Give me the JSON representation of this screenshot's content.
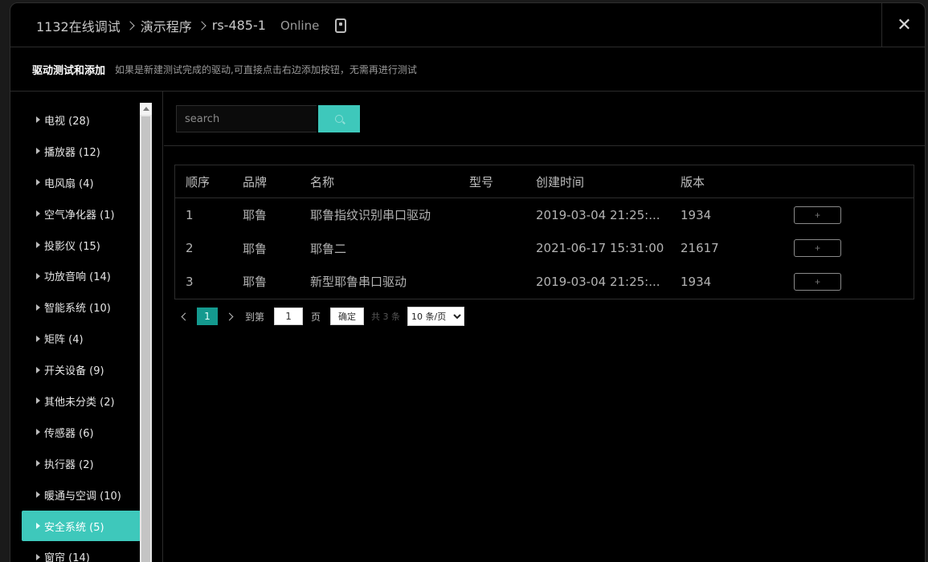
{
  "header": {
    "breadcrumb": [
      "1132在线调试",
      "演示程序",
      "rs-485-1"
    ],
    "status": "Online",
    "close_label": "✕"
  },
  "subheader": {
    "title": "驱动测试和添加",
    "description": "如果是新建测试完成的驱动,可直接点击右边添加按钮，无需再进行测试"
  },
  "sidebar": {
    "items": [
      {
        "label": "电视 (28)"
      },
      {
        "label": "播放器 (12)"
      },
      {
        "label": "电风扇 (4)"
      },
      {
        "label": "空气净化器 (1)"
      },
      {
        "label": "投影仪 (15)"
      },
      {
        "label": "功放音响 (14)"
      },
      {
        "label": "智能系统 (10)"
      },
      {
        "label": "矩阵 (4)"
      },
      {
        "label": "开关设备 (9)"
      },
      {
        "label": "其他未分类 (2)"
      },
      {
        "label": "传感器 (6)"
      },
      {
        "label": "执行器 (2)"
      },
      {
        "label": "暖通与空调 (10)"
      },
      {
        "label": "安全系统 (5)",
        "active": true
      },
      {
        "label": "窗帘 (14)"
      }
    ]
  },
  "search": {
    "placeholder": "search",
    "value": ""
  },
  "table": {
    "columns": [
      "顺序",
      "品牌",
      "名称",
      "型号",
      "创建时间",
      "版本",
      ""
    ],
    "rows": [
      {
        "index": "1",
        "brand": "耶鲁",
        "name": "耶鲁指纹识别串口驱动",
        "model": "",
        "created": "2019-03-04 21:25:...",
        "version": "1934",
        "action": "+"
      },
      {
        "index": "2",
        "brand": "耶鲁",
        "name": "耶鲁二",
        "model": "",
        "created": "2021-06-17 15:31:00",
        "version": "21617",
        "action": "+"
      },
      {
        "index": "3",
        "brand": "耶鲁",
        "name": "新型耶鲁串口驱动",
        "model": "",
        "created": "2019-03-04 21:25:...",
        "version": "1934",
        "action": "+"
      }
    ]
  },
  "pagination": {
    "current_page": "1",
    "goto_label": "到第",
    "goto_value": "1",
    "page_unit": "页",
    "confirm_label": "确定",
    "total_text": "共 3 条",
    "page_size_options": [
      "10 条/页"
    ],
    "page_size_selected": "10 条/页"
  },
  "colors": {
    "accent": "#3ec8bb",
    "page_active": "#149a8f",
    "background": "#000000"
  }
}
